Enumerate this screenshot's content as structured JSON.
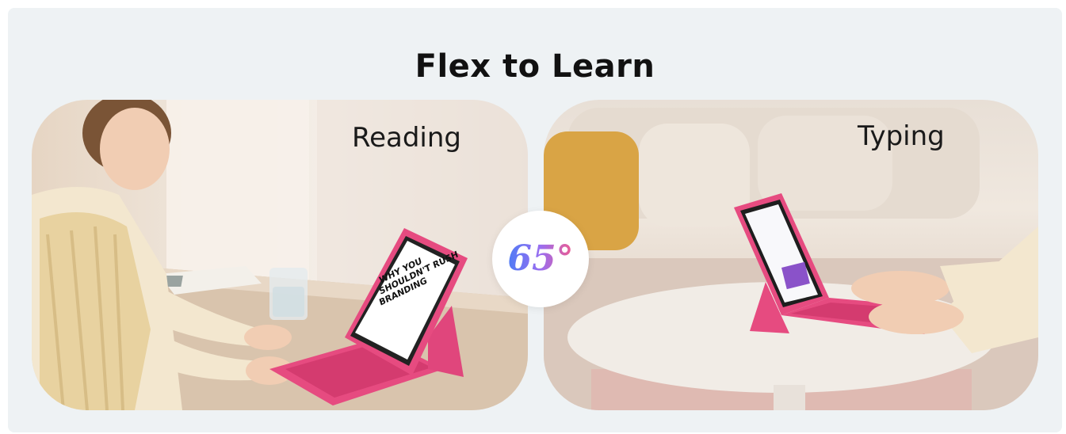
{
  "title": "Flex to Learn",
  "panels": [
    {
      "label": "Reading",
      "scene": "woman-reading-on-tablet-photo"
    },
    {
      "label": "Typing",
      "scene": "hands-typing-on-tablet-keyboard-photo"
    }
  ],
  "badge": {
    "text": "65°"
  },
  "tablet_screen_text": [
    "WHY YOU",
    "SHOULDN'T RUSH",
    "BRANDING"
  ],
  "colors": {
    "background": "#eef2f4",
    "title": "#111111",
    "case_pink": "#e64b80",
    "badge_gradient_start": "#4e7cf5",
    "badge_gradient_end": "#ef5b8e"
  }
}
